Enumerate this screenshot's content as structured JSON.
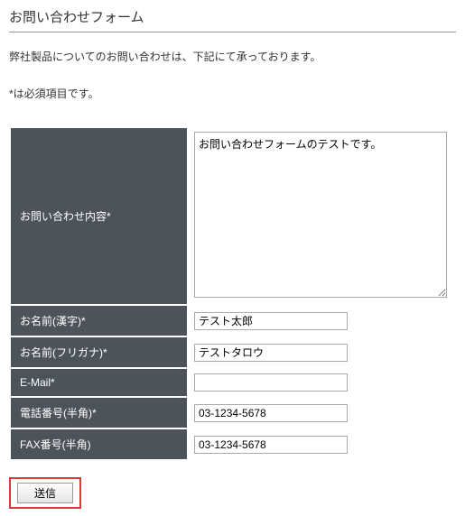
{
  "title": "お問い合わせフォーム",
  "intro": "弊社製品についてのお問い合わせは、下記にて承っております。",
  "required_note": "*は必須項目です。",
  "fields": {
    "content": {
      "label": "お問い合わせ内容*",
      "value": "お問い合わせフォームのテストです。"
    },
    "name_kanji": {
      "label": "お名前(漢字)*",
      "value": "テスト太郎"
    },
    "name_kana": {
      "label": "お名前(フリガナ)*",
      "value": "テストタロウ"
    },
    "email": {
      "label": "E-Mail*",
      "value": ""
    },
    "tel": {
      "label": "電話番号(半角)*",
      "value": "03-1234-5678"
    },
    "fax": {
      "label": "FAX番号(半角)",
      "value": "03-1234-5678"
    }
  },
  "submit_label": "送信"
}
